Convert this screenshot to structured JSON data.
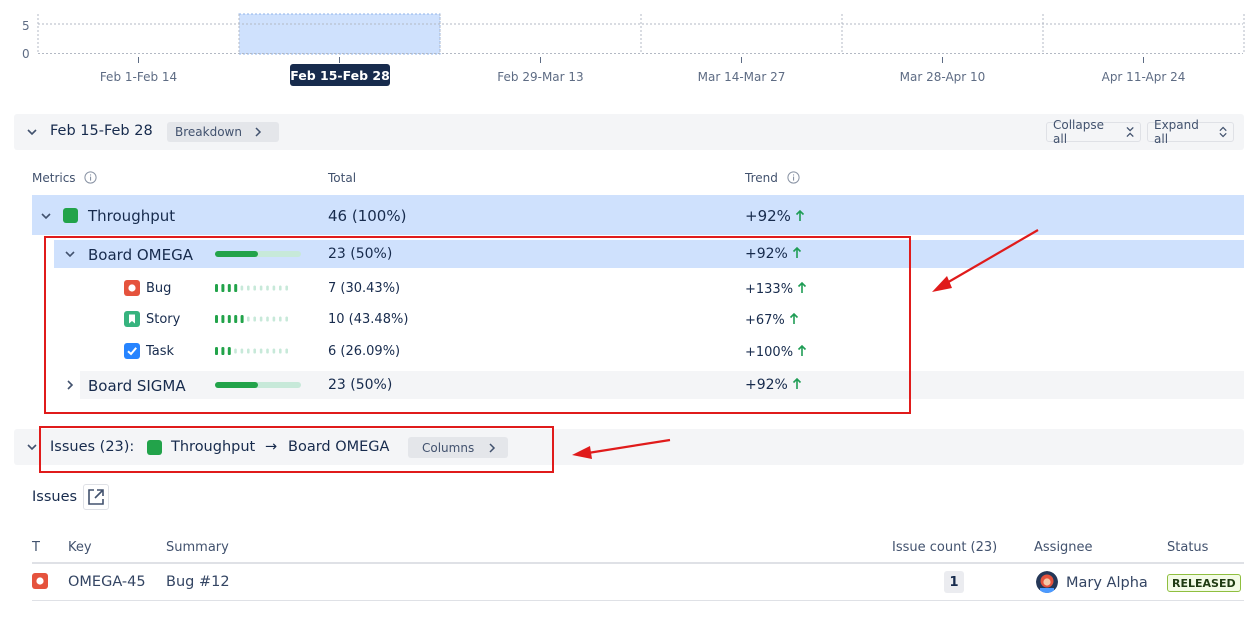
{
  "chart": {
    "y_ticks": [
      "5",
      "0"
    ],
    "periods": [
      "Feb 1-Feb 14",
      "Feb 15-Feb 28",
      "Feb 29-Mar 13",
      "Mar 14-Mar 27",
      "Mar 28-Apr 10",
      "Apr 11-Apr 24"
    ],
    "selected_index": 1,
    "selected_label": "Feb 15-Feb 28",
    "selection_color": "#cfe1fd"
  },
  "period_section": {
    "title": "Feb 15-Feb 28",
    "breakdown_label": "Breakdown",
    "collapse_all_label": "Collapse all",
    "expand_all_label": "Expand all"
  },
  "metrics_table": {
    "col_metrics": "Metrics",
    "col_total": "Total",
    "col_trend": "Trend",
    "throughput": {
      "label": "Throughput",
      "total": "46 (100%)",
      "trend": "+92%",
      "color": "#22a34a"
    },
    "boards": [
      {
        "label": "Board OMEGA",
        "total": "23 (50%)",
        "trend": "+92%",
        "share": 0.5,
        "expanded": true,
        "types": [
          {
            "icon": "bug-icon",
            "label": "Bug",
            "total": "7 (30.43%)",
            "trend": "+133%",
            "share": 0.3043,
            "color": "#e5533d"
          },
          {
            "icon": "story-icon",
            "label": "Story",
            "total": "10 (43.48%)",
            "trend": "+67%",
            "share": 0.4348,
            "color": "#36b37e"
          },
          {
            "icon": "task-icon",
            "label": "Task",
            "total": "6 (26.09%)",
            "trend": "+100%",
            "share": 0.2609,
            "color": "#2684ff"
          }
        ]
      },
      {
        "label": "Board SIGMA",
        "total": "23 (50%)",
        "trend": "+92%",
        "share": 0.5,
        "expanded": false
      }
    ]
  },
  "issues_section": {
    "title": "Issues (23):",
    "metric": "Throughput",
    "arrow": "→",
    "board": "Board OMEGA",
    "columns_label": "Columns"
  },
  "issues_table": {
    "heading": "Issues",
    "col_t": "T",
    "col_key": "Key",
    "col_summary": "Summary",
    "col_count": "Issue count (23)",
    "col_assignee": "Assignee",
    "col_status": "Status",
    "rows": [
      {
        "type_icon": "bug-icon",
        "key": "OMEGA-45",
        "summary": "Bug #12",
        "count": "1",
        "assignee": "Mary Alpha",
        "status": "RELEASED"
      }
    ]
  },
  "colors": {
    "trend_up": "#1f9d55",
    "annotation": "#e01b1b",
    "accent": "#22a34a"
  }
}
